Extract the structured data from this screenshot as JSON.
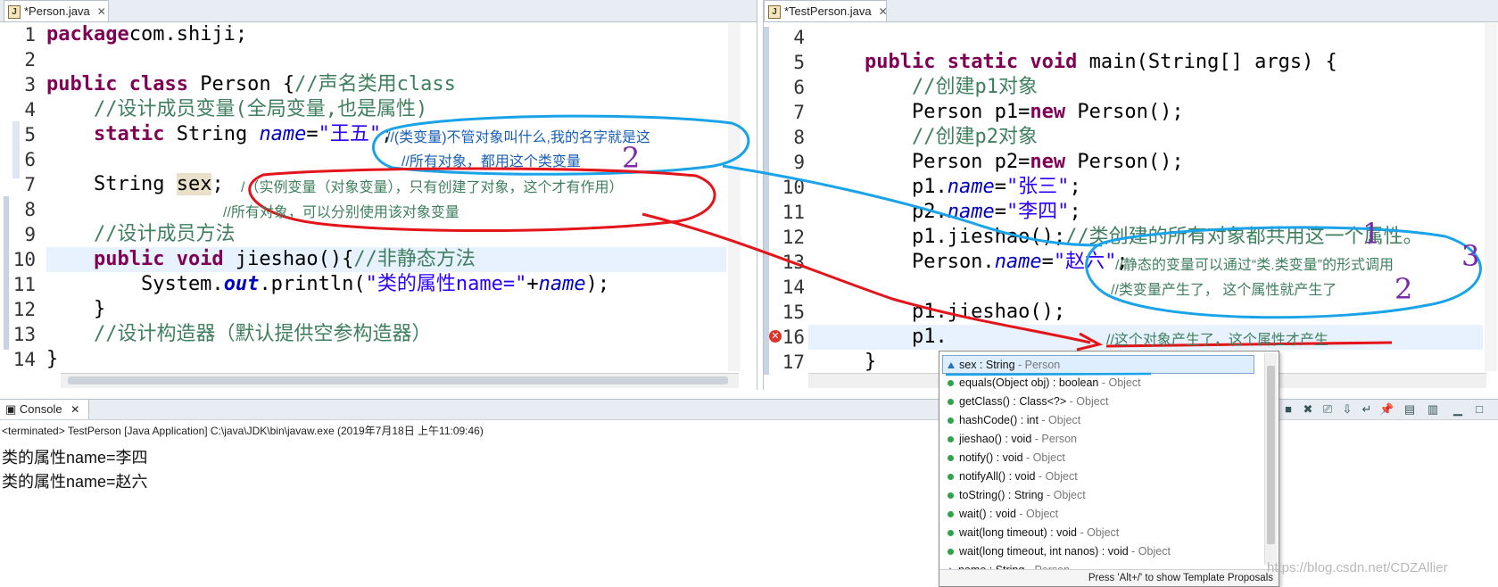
{
  "left_editor": {
    "tab_label": "*Person.java",
    "lines": [
      {
        "n": "1",
        "html_tokens": [
          [
            "kw",
            "package"
          ],
          [
            "",
            "com.shiji;"
          ]
        ]
      },
      {
        "n": "2",
        "html_tokens": []
      },
      {
        "n": "3",
        "html_tokens": [
          [
            "kw",
            "public class"
          ],
          [
            "",
            " Person {"
          ],
          [
            "cm",
            "//声名类用class"
          ]
        ]
      },
      {
        "n": "4",
        "html_tokens": [
          [
            "",
            "    "
          ],
          [
            "cm",
            "//设计成员变量(全局变量,也是属性)"
          ]
        ]
      },
      {
        "n": "5",
        "html_tokens": [
          [
            "",
            "    "
          ],
          [
            "kw",
            "static"
          ],
          [
            "",
            " String "
          ],
          [
            "fi",
            "name"
          ],
          [
            "",
            "="
          ],
          [
            "st",
            "\"王五\""
          ],
          [
            "",
            ";"
          ]
        ]
      },
      {
        "n": "6",
        "html_tokens": []
      },
      {
        "n": "7",
        "html_tokens": [
          [
            "",
            "    String "
          ],
          [
            "sex",
            "sex"
          ],
          [
            "",
            ";"
          ]
        ]
      },
      {
        "n": "8",
        "html_tokens": []
      },
      {
        "n": "9",
        "html_tokens": [
          [
            "",
            "    "
          ],
          [
            "cm",
            "//设计成员方法"
          ]
        ]
      },
      {
        "n": "10",
        "html_tokens": [
          [
            "",
            "    "
          ],
          [
            "kw",
            "public void"
          ],
          [
            "",
            " jieshao(){"
          ],
          [
            "cm",
            "//非静态方法"
          ]
        ]
      },
      {
        "n": "11",
        "html_tokens": [
          [
            "",
            "        System."
          ],
          [
            "sf",
            "out"
          ],
          [
            "",
            ".println("
          ],
          [
            "st",
            "\"类的属性name=\""
          ],
          [
            "",
            "+"
          ],
          [
            "fi",
            "name"
          ],
          [
            "",
            ");"
          ]
        ]
      },
      {
        "n": "12",
        "html_tokens": [
          [
            "",
            "    }"
          ]
        ]
      },
      {
        "n": "13",
        "html_tokens": [
          [
            "",
            "    "
          ],
          [
            "cm",
            "//设计构造器（默认提供空参构造器）"
          ]
        ]
      },
      {
        "n": "14",
        "html_tokens": [
          [
            "",
            "}"
          ]
        ]
      }
    ]
  },
  "right_editor": {
    "tab_label": "*TestPerson.java",
    "lines": [
      {
        "n": "4",
        "html_tokens": []
      },
      {
        "n": "5",
        "html_tokens": [
          [
            "",
            "    "
          ],
          [
            "kw",
            "public static void"
          ],
          [
            "",
            " main(String[] args) {"
          ]
        ]
      },
      {
        "n": "6",
        "html_tokens": [
          [
            "",
            "        "
          ],
          [
            "cm",
            "//创建p1对象"
          ]
        ]
      },
      {
        "n": "7",
        "html_tokens": [
          [
            "",
            "        Person p1="
          ],
          [
            "kw",
            "new"
          ],
          [
            "",
            " Person();"
          ]
        ]
      },
      {
        "n": "8",
        "html_tokens": [
          [
            "",
            "        "
          ],
          [
            "cm",
            "//创建p2对象"
          ]
        ]
      },
      {
        "n": "9",
        "html_tokens": [
          [
            "",
            "        Person p2="
          ],
          [
            "kw",
            "new"
          ],
          [
            "",
            " Person();"
          ]
        ]
      },
      {
        "n": "10",
        "html_tokens": [
          [
            "",
            "        p1."
          ],
          [
            "fi",
            "name"
          ],
          [
            "",
            "="
          ],
          [
            "st",
            "\"张三\""
          ],
          [
            "",
            ";"
          ]
        ]
      },
      {
        "n": "11",
        "html_tokens": [
          [
            "",
            "        p2."
          ],
          [
            "fi",
            "name"
          ],
          [
            "",
            "="
          ],
          [
            "st",
            "\"李四\""
          ],
          [
            "",
            ";"
          ]
        ]
      },
      {
        "n": "12",
        "html_tokens": [
          [
            "",
            "        p1.jieshao();"
          ],
          [
            "cm",
            "//类创建的所有对象都共用这一个属性。"
          ]
        ]
      },
      {
        "n": "13",
        "html_tokens": [
          [
            "",
            "        Person."
          ],
          [
            "fi",
            "name"
          ],
          [
            "",
            "="
          ],
          [
            "st",
            "\"赵六\""
          ],
          [
            "",
            ";"
          ]
        ]
      },
      {
        "n": "14",
        "html_tokens": []
      },
      {
        "n": "15",
        "html_tokens": [
          [
            "",
            "        p1.jieshao();"
          ]
        ]
      },
      {
        "n": "16",
        "html_tokens": [
          [
            "",
            "        p1."
          ]
        ]
      },
      {
        "n": "17",
        "html_tokens": [
          [
            "",
            "    }"
          ]
        ]
      }
    ]
  },
  "annotations": {
    "blue_1": "//(类变量)不管对象叫什么,我的名字就是这",
    "blue_2": "//所有对象，都用这个类变量",
    "red_1": "/（实例变量（对象变量），只有创建了对象，这个才有作用）",
    "red_2": "//所有对象，可以分别使用该对象变量",
    "right_13": "//静态的变量可以通过“类.类变量”的形式调用",
    "right_14": "//类变量产生了， 这个属性就产生了",
    "right_16": "//这个对象产生了，这个属性才产生",
    "num_2a": "2",
    "num_1": "1",
    "num_3": "3",
    "num_2b": "2"
  },
  "console": {
    "tab_label": "Console",
    "status": "<terminated> TestPerson [Java Application] C:\\java\\JDK\\bin\\javaw.exe (2019年7月18日 上午11:09:46)",
    "output": [
      "类的属性name=李四",
      "类的属性name=赵六"
    ]
  },
  "content_assist": {
    "items": [
      {
        "sig": "sex : String",
        "owner": " - Person",
        "kind": "field",
        "selected": true
      },
      {
        "sig": "equals(Object obj) : boolean",
        "owner": " - Object",
        "kind": "method"
      },
      {
        "sig": "getClass() : Class<?>",
        "owner": " - Object",
        "kind": "method"
      },
      {
        "sig": "hashCode() : int",
        "owner": " - Object",
        "kind": "method"
      },
      {
        "sig": "jieshao() : void",
        "owner": " - Person",
        "kind": "method"
      },
      {
        "sig": "notify() : void",
        "owner": " - Object",
        "kind": "method"
      },
      {
        "sig": "notifyAll() : void",
        "owner": " - Object",
        "kind": "method"
      },
      {
        "sig": "toString() : String",
        "owner": " - Object",
        "kind": "method"
      },
      {
        "sig": "wait() : void",
        "owner": " - Object",
        "kind": "method"
      },
      {
        "sig": "wait(long timeout) : void",
        "owner": " - Object",
        "kind": "method"
      },
      {
        "sig": "wait(long timeout, int nanos) : void",
        "owner": " - Object",
        "kind": "method"
      },
      {
        "sig": "name : String",
        "owner": " - Person",
        "kind": "static-field"
      }
    ],
    "footer": "Press 'Alt+/' to show Template Proposals"
  },
  "watermark": "https://blog.csdn.net/CDZAllier",
  "colors": {
    "keyword": "#7f0055",
    "comment": "#3f7f5f",
    "string": "#2a00ff",
    "field": "#0000c0",
    "annotation_blue": "#1aa3e8",
    "annotation_red": "#e3151a",
    "annotation_purple": "#7a2aa8"
  }
}
